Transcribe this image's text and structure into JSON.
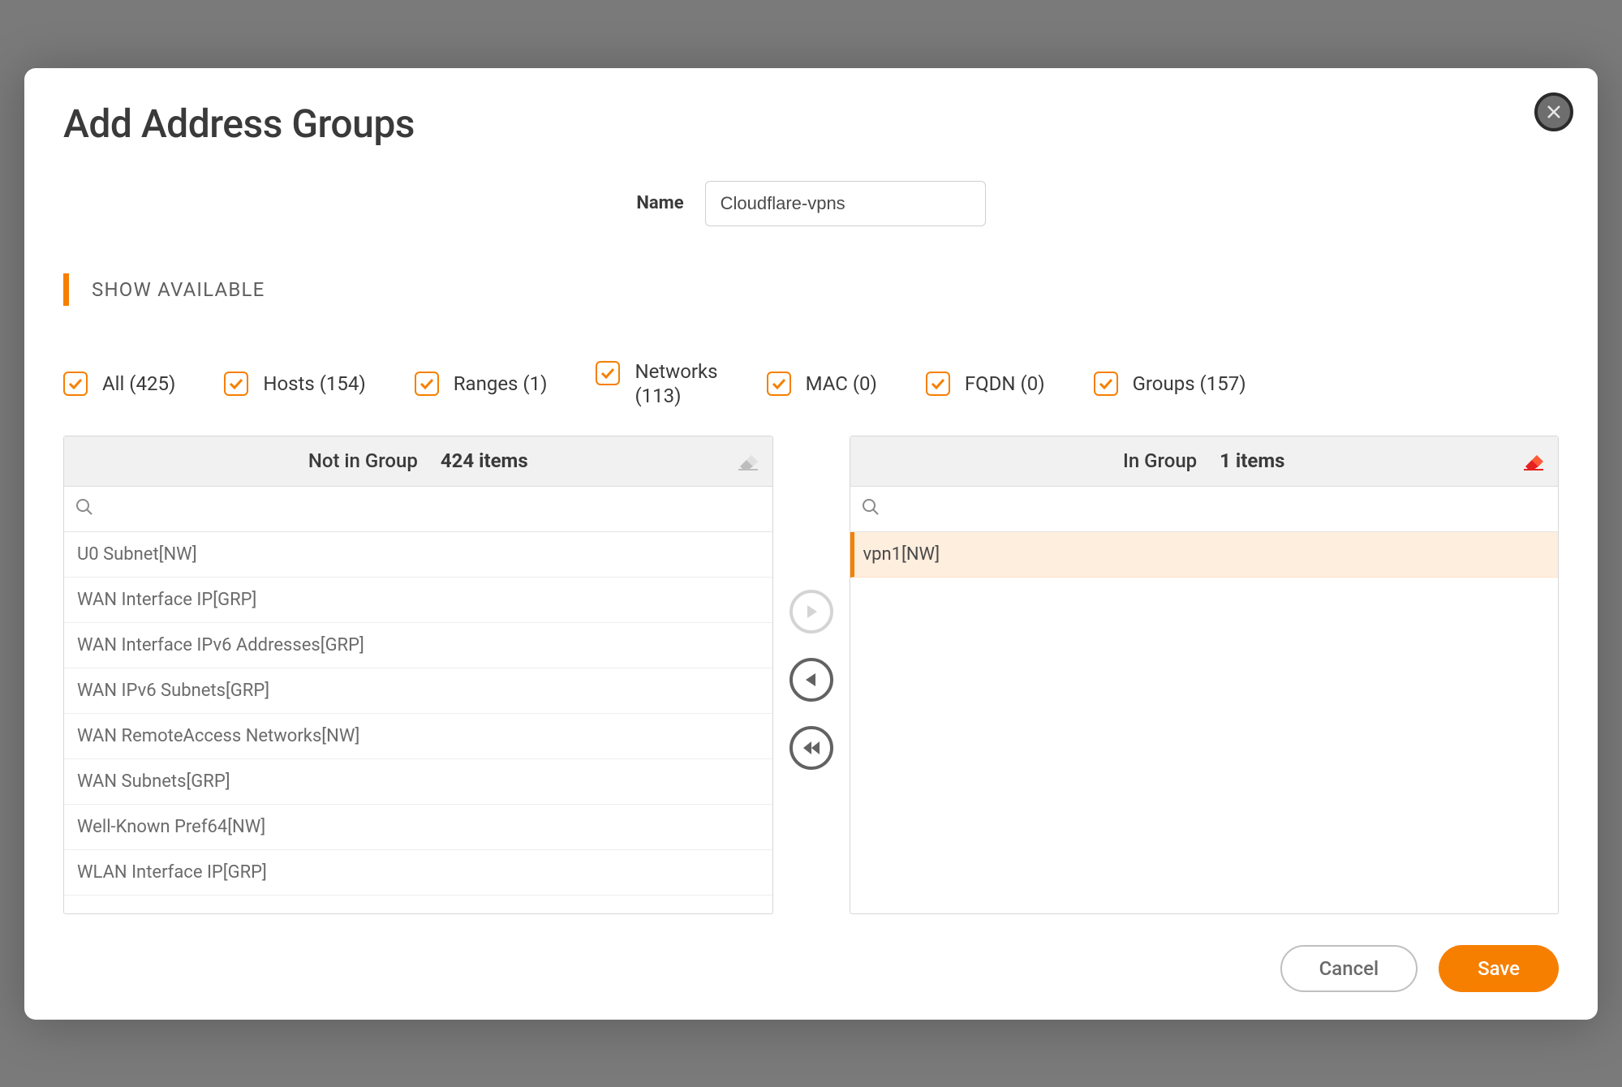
{
  "modal": {
    "title": "Add Address Groups",
    "name_label": "Name",
    "name_value": "Cloudflare-vpns",
    "section_label": "SHOW AVAILABLE"
  },
  "filters": {
    "all": {
      "label": "All (425)"
    },
    "hosts": {
      "label": "Hosts (154)"
    },
    "ranges": {
      "label": "Ranges (1)"
    },
    "networks": {
      "label_line1": "Networks",
      "label_line2": "(113)"
    },
    "mac": {
      "label": "MAC (0)"
    },
    "fqdn": {
      "label": "FQDN (0)"
    },
    "groups": {
      "label": "Groups (157)"
    }
  },
  "left": {
    "title": "Not in Group",
    "count": "424 items",
    "items": [
      "U0 Subnet[NW]",
      "WAN Interface IP[GRP]",
      "WAN Interface IPv6 Addresses[GRP]",
      "WAN IPv6 Subnets[GRP]",
      "WAN RemoteAccess Networks[NW]",
      "WAN Subnets[GRP]",
      "Well-Known Pref64[NW]",
      "WLAN Interface IP[GRP]"
    ]
  },
  "right": {
    "title": "In Group",
    "count": "1 items",
    "items": [
      "vpn1[NW]"
    ]
  },
  "footer": {
    "cancel": "Cancel",
    "save": "Save"
  }
}
